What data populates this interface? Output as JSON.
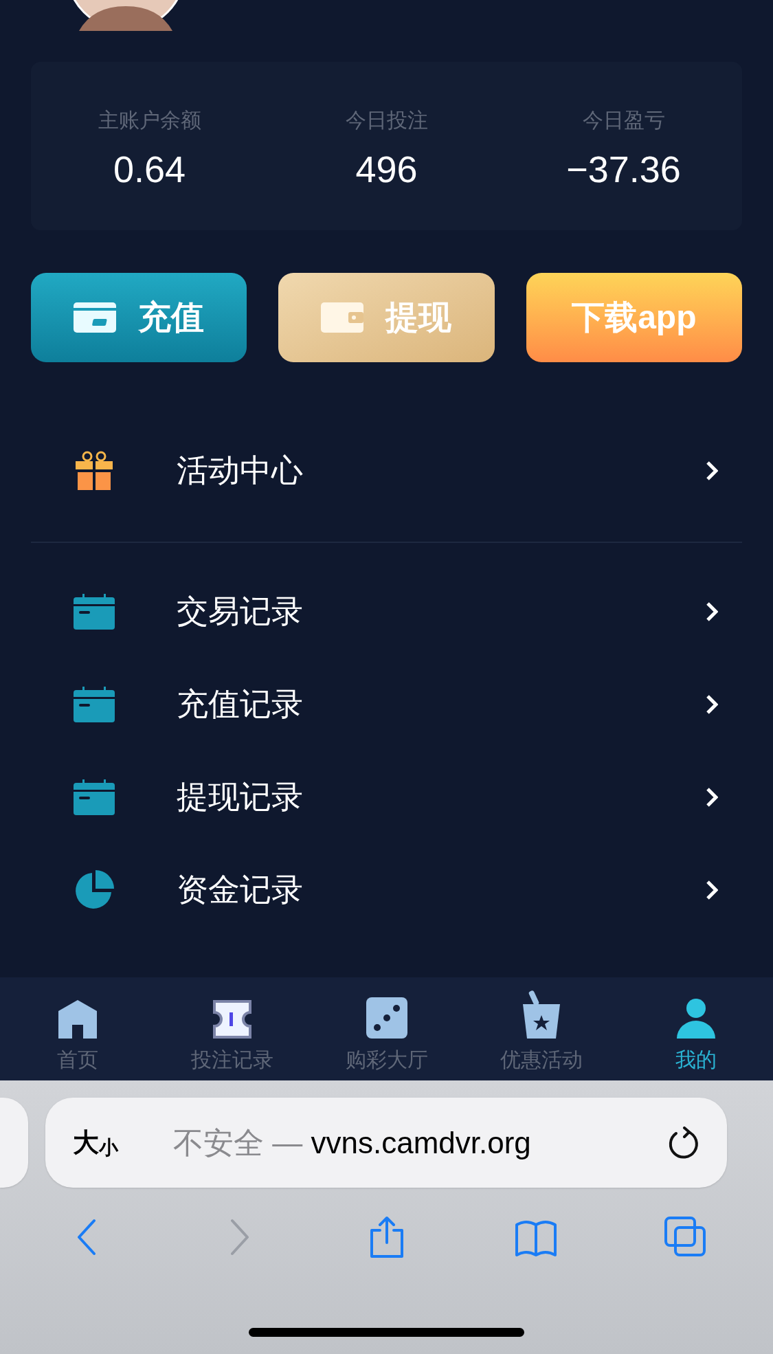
{
  "stats": [
    {
      "label": "主账户余额",
      "value": "0.64"
    },
    {
      "label": "今日投注",
      "value": "496"
    },
    {
      "label": "今日盈亏",
      "value": "−37.36"
    }
  ],
  "actions": [
    {
      "kind": "deposit",
      "label": "充值"
    },
    {
      "kind": "withdraw",
      "label": "提现"
    },
    {
      "kind": "download",
      "label": "下载app"
    }
  ],
  "menu_sections": [
    [
      {
        "kind": "gift",
        "label": "活动中心"
      }
    ],
    [
      {
        "kind": "calendar",
        "label": "交易记录"
      },
      {
        "kind": "calendar",
        "label": "充值记录"
      },
      {
        "kind": "calendar",
        "label": "提现记录"
      },
      {
        "kind": "pie",
        "label": "资金记录"
      }
    ]
  ],
  "tab_bar": [
    {
      "kind": "home",
      "label": "首页",
      "selected": false
    },
    {
      "kind": "ticket",
      "label": "投注记录",
      "selected": false
    },
    {
      "kind": "dice",
      "label": "购彩大厅",
      "selected": false
    },
    {
      "kind": "bucket",
      "label": "优惠活动",
      "selected": false
    },
    {
      "kind": "person",
      "label": "我的",
      "selected": true
    }
  ],
  "browser": {
    "text_size": {
      "large": "大",
      "small": "小"
    },
    "security": "不安全 —",
    "host": "vvns.camdvr.org",
    "toolbar": [
      {
        "kind": "back",
        "disabled": false
      },
      {
        "kind": "forward",
        "disabled": true
      },
      {
        "kind": "share",
        "disabled": false
      },
      {
        "kind": "bookmarks",
        "disabled": false
      },
      {
        "kind": "tabs",
        "disabled": false
      }
    ]
  }
}
